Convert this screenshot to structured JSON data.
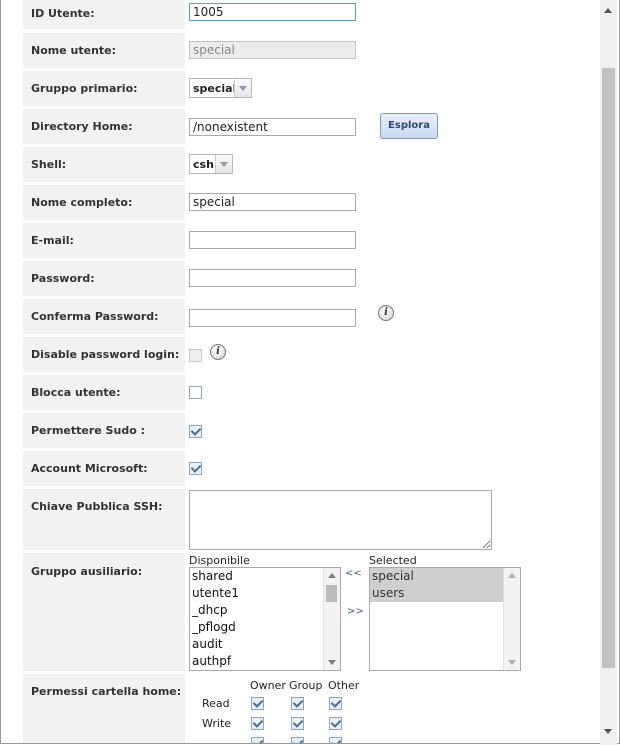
{
  "form": {
    "user_id": {
      "label": "ID Utente:",
      "value": "1005"
    },
    "username": {
      "label": "Nome utente:",
      "value": "special"
    },
    "primary_group": {
      "label": "Gruppo primario:",
      "value": "special"
    },
    "home_dir": {
      "label": "Directory Home:",
      "value": "/nonexistent",
      "browse_label": "Esplora"
    },
    "shell": {
      "label": "Shell:",
      "value": "csh"
    },
    "full_name": {
      "label": "Nome completo:",
      "value": "special"
    },
    "email": {
      "label": "E-mail:",
      "value": ""
    },
    "password": {
      "label": "Password:",
      "value": ""
    },
    "confirm_password": {
      "label": "Conferma Password:",
      "value": ""
    },
    "disable_password_login": {
      "label": "Disable password login:",
      "checked": false,
      "disabled": true
    },
    "lock_user": {
      "label": "Blocca utente:",
      "checked": false
    },
    "allow_sudo": {
      "label": "Permettere Sudo :",
      "checked": true
    },
    "microsoft_account": {
      "label": "Account Microsoft:",
      "checked": true
    },
    "ssh_key": {
      "label": "Chiave Pubblica SSH:",
      "value": ""
    },
    "aux_groups": {
      "label": "Gruppo ausiliario:",
      "available_label": "Disponibile",
      "selected_label": "Selected",
      "available": [
        "shared",
        "utente1",
        "_dhcp",
        "_pflogd",
        "audit",
        "authpf"
      ],
      "selected": [
        "special",
        "users"
      ],
      "move_left": "<<",
      "move_right": ">>"
    },
    "home_permissions": {
      "label": "Permessi cartella home:",
      "columns": [
        "Owner",
        "Group",
        "Other"
      ],
      "rows": [
        {
          "name": "Read",
          "values": [
            true,
            true,
            true
          ]
        },
        {
          "name": "Write",
          "values": [
            true,
            true,
            true
          ]
        }
      ]
    }
  },
  "icons": {
    "info": "info-icon"
  }
}
